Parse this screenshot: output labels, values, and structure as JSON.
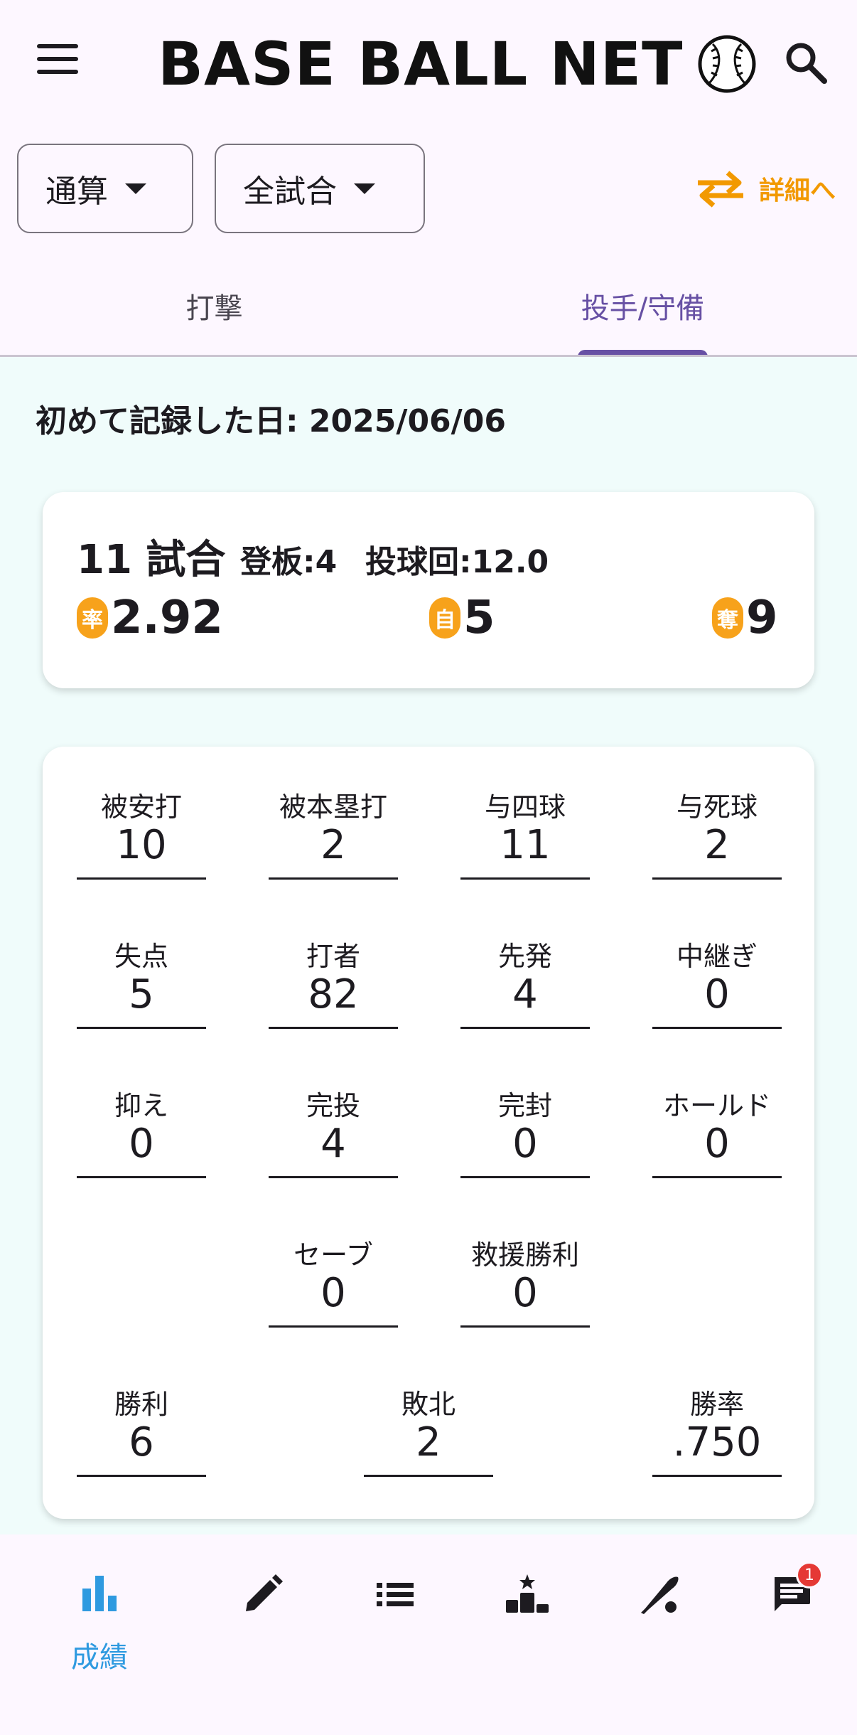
{
  "header": {
    "brand": "BASE BALL NET",
    "icons": {
      "menu": "menu-icon",
      "search": "search-icon",
      "ball": "baseball-icon"
    }
  },
  "filters": {
    "period": "通算",
    "games": "全試合",
    "detail_link": "詳細へ"
  },
  "tabs": [
    {
      "label": "打撃",
      "active": false
    },
    {
      "label": "投手/守備",
      "active": true
    }
  ],
  "first_record": "初めて記録した日: 2025/06/06",
  "summary": {
    "games": "11 試合",
    "appearances": "登板:4",
    "innings": "投球回:12.0",
    "era_badge": "率",
    "era": "2.92",
    "er_badge": "自",
    "er": "5",
    "so_badge": "奪",
    "so": "9"
  },
  "stats": [
    {
      "label": "被安打",
      "value": "10"
    },
    {
      "label": "被本塁打",
      "value": "2"
    },
    {
      "label": "与四球",
      "value": "11"
    },
    {
      "label": "与死球",
      "value": "2"
    },
    {
      "label": "失点",
      "value": "5"
    },
    {
      "label": "打者",
      "value": "82"
    },
    {
      "label": "先発",
      "value": "4"
    },
    {
      "label": "中継ぎ",
      "value": "0"
    },
    {
      "label": "抑え",
      "value": "0"
    },
    {
      "label": "完投",
      "value": "4"
    },
    {
      "label": "完封",
      "value": "0"
    },
    {
      "label": "ホールド",
      "value": "0"
    },
    {
      "label": "セーブ",
      "value": "0"
    },
    {
      "label": "救援勝利",
      "value": "0"
    },
    {
      "label": "勝利",
      "value": "6"
    },
    {
      "label": "敗北",
      "value": "2"
    },
    {
      "label": "勝率",
      "value": ".750"
    }
  ],
  "bottom_nav": {
    "items": [
      {
        "icon": "bar-chart-icon",
        "label": "成績",
        "active": true
      },
      {
        "icon": "pencil-icon"
      },
      {
        "icon": "list-icon"
      },
      {
        "icon": "ranking-podium-icon"
      },
      {
        "icon": "baseball-bat-icon"
      },
      {
        "icon": "chat-icon"
      }
    ],
    "chat_badge": "1"
  },
  "colors": {
    "accent": "#6750a4",
    "orange": "#f29900",
    "badge": "#f7a21b",
    "nav_active": "#2f9ae0",
    "content_bg": "#f0fcfb"
  }
}
